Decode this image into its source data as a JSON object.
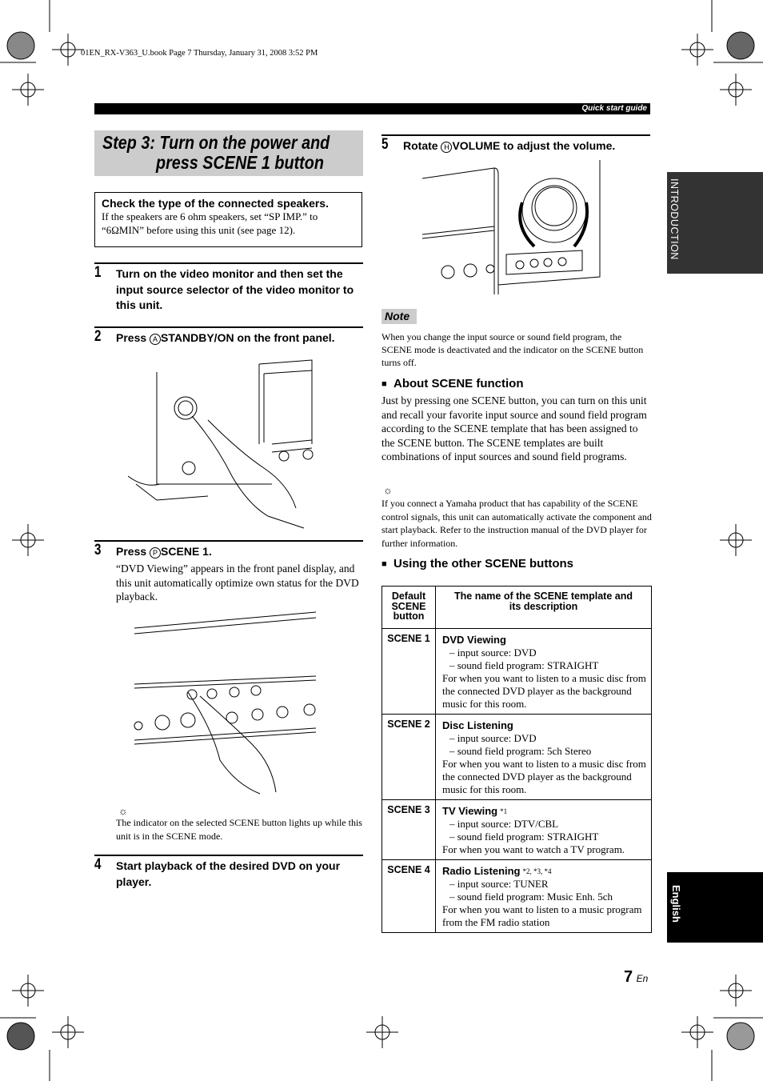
{
  "header_meta": "01EN_RX-V363_U.book  Page 7  Thursday, January 31, 2008  3:52 PM",
  "banner": "Quick start guide",
  "side_tabs": {
    "introduction": "INTRODUCTION",
    "english": "English"
  },
  "title": {
    "line1": "Step 3: Turn on the power and",
    "line2": "press SCENE 1 button"
  },
  "check_box": {
    "heading": "Check the type of the connected speakers.",
    "text": "If the speakers are 6 ohm speakers, set “SP IMP.” to “6ΩMIN” before using this unit (see page 12)."
  },
  "steps": [
    {
      "num": "1",
      "text": "Turn on the video monitor and then set the input source selector of the video monitor to this unit."
    },
    {
      "num": "2",
      "pre": "Press ",
      "key": "A",
      "button": "STANDBY/ON",
      "post": " on the front panel."
    },
    {
      "num": "3",
      "pre": "Press ",
      "key": "P",
      "button": "SCENE 1",
      "post": ".",
      "body": "“DVD Viewing” appears in the front panel display, and this unit automatically optimize own status for the DVD playback.",
      "tip": "The indicator on the selected SCENE button lights up while this unit is in the SCENE mode."
    },
    {
      "num": "4",
      "text": "Start playback of the desired DVD on your player."
    },
    {
      "num": "5",
      "pre": "Rotate ",
      "key": "H",
      "button": "VOLUME",
      "post": " to adjust the volume."
    }
  ],
  "note": {
    "label": "Note",
    "text": "When you change the input source or sound field program, the SCENE mode is deactivated and the indicator on the SCENE button turns off."
  },
  "about": {
    "heading": "About SCENE function",
    "text": "Just by pressing one SCENE button, you can turn on this unit and recall your favorite input source and sound field program according to the SCENE template that has been assigned to the SCENE button. The SCENE templates are built combinations of input sources and sound field programs.",
    "tip": "If you connect a Yamaha product that has capability of the SCENE control signals, this unit can automatically activate the component and start playback. Refer to the instruction manual of the DVD player for further information."
  },
  "other": {
    "heading": "Using the other SCENE buttons"
  },
  "table": {
    "headers": [
      "Default SCENE button",
      "The name of the SCENE template and its description"
    ],
    "rows": [
      {
        "button": "SCENE 1",
        "name": "DVD Viewing",
        "note": "",
        "lines": [
          "– input source: DVD",
          "– sound field program: STRAIGHT"
        ],
        "desc": "For when you want to listen to a music disc from the connected DVD player as the background music for this room."
      },
      {
        "button": "SCENE 2",
        "name": "Disc Listening",
        "note": "",
        "lines": [
          "– input source: DVD",
          "– sound field program: 5ch Stereo"
        ],
        "desc": "For when you want to listen to a music disc from the connected DVD player as the background music for this room."
      },
      {
        "button": "SCENE 3",
        "name": "TV Viewing",
        "note": "*1",
        "lines": [
          "– input source: DTV/CBL",
          "– sound field program: STRAIGHT"
        ],
        "desc": "For when you want to watch a TV program."
      },
      {
        "button": "SCENE 4",
        "name": "Radio Listening",
        "note": "*2, *3, *4",
        "lines": [
          "– input source: TUNER",
          "– sound field program: Music Enh. 5ch"
        ],
        "desc": "For when you want to listen to a music program from the FM radio station"
      }
    ]
  },
  "footer": {
    "page": "7",
    "lang": "En"
  }
}
